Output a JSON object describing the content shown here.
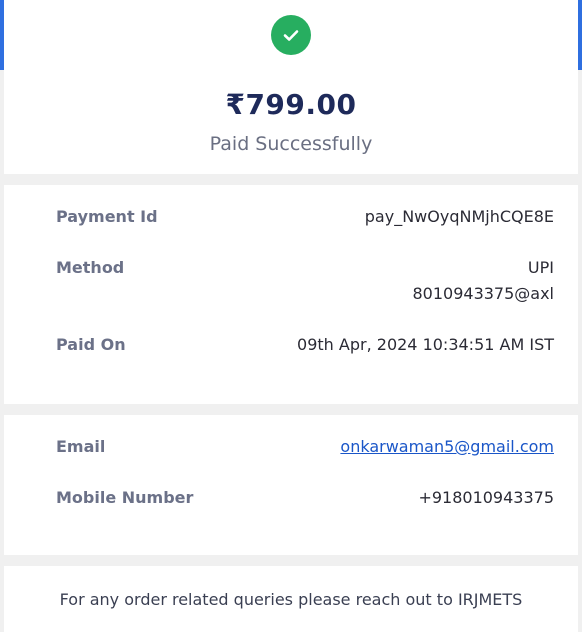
{
  "colors": {
    "accent": "#2f6fe0",
    "success": "#27ae60",
    "amount_text": "#1e2a5a",
    "link": "#1a56c8"
  },
  "header": {
    "icon": "check-circle-icon",
    "currency_symbol": "₹",
    "amount_main": "799",
    "amount_decimal": ".00",
    "status": "Paid Successfully"
  },
  "details": {
    "payment_id_label": "Payment Id",
    "payment_id_value": "pay_NwOyqNMjhCQE8E",
    "method_label": "Method",
    "method_type": "UPI",
    "method_vpa": "8010943375@axl",
    "paid_on_label": "Paid On",
    "paid_on_value": "09th Apr, 2024 10:34:51 AM IST"
  },
  "contact": {
    "email_label": "Email",
    "email_value": "onkarwaman5@gmail.com",
    "mobile_label": "Mobile Number",
    "mobile_value": "+918010943375"
  },
  "footer": {
    "text": "For any order related queries please reach out to IRJMETS"
  }
}
